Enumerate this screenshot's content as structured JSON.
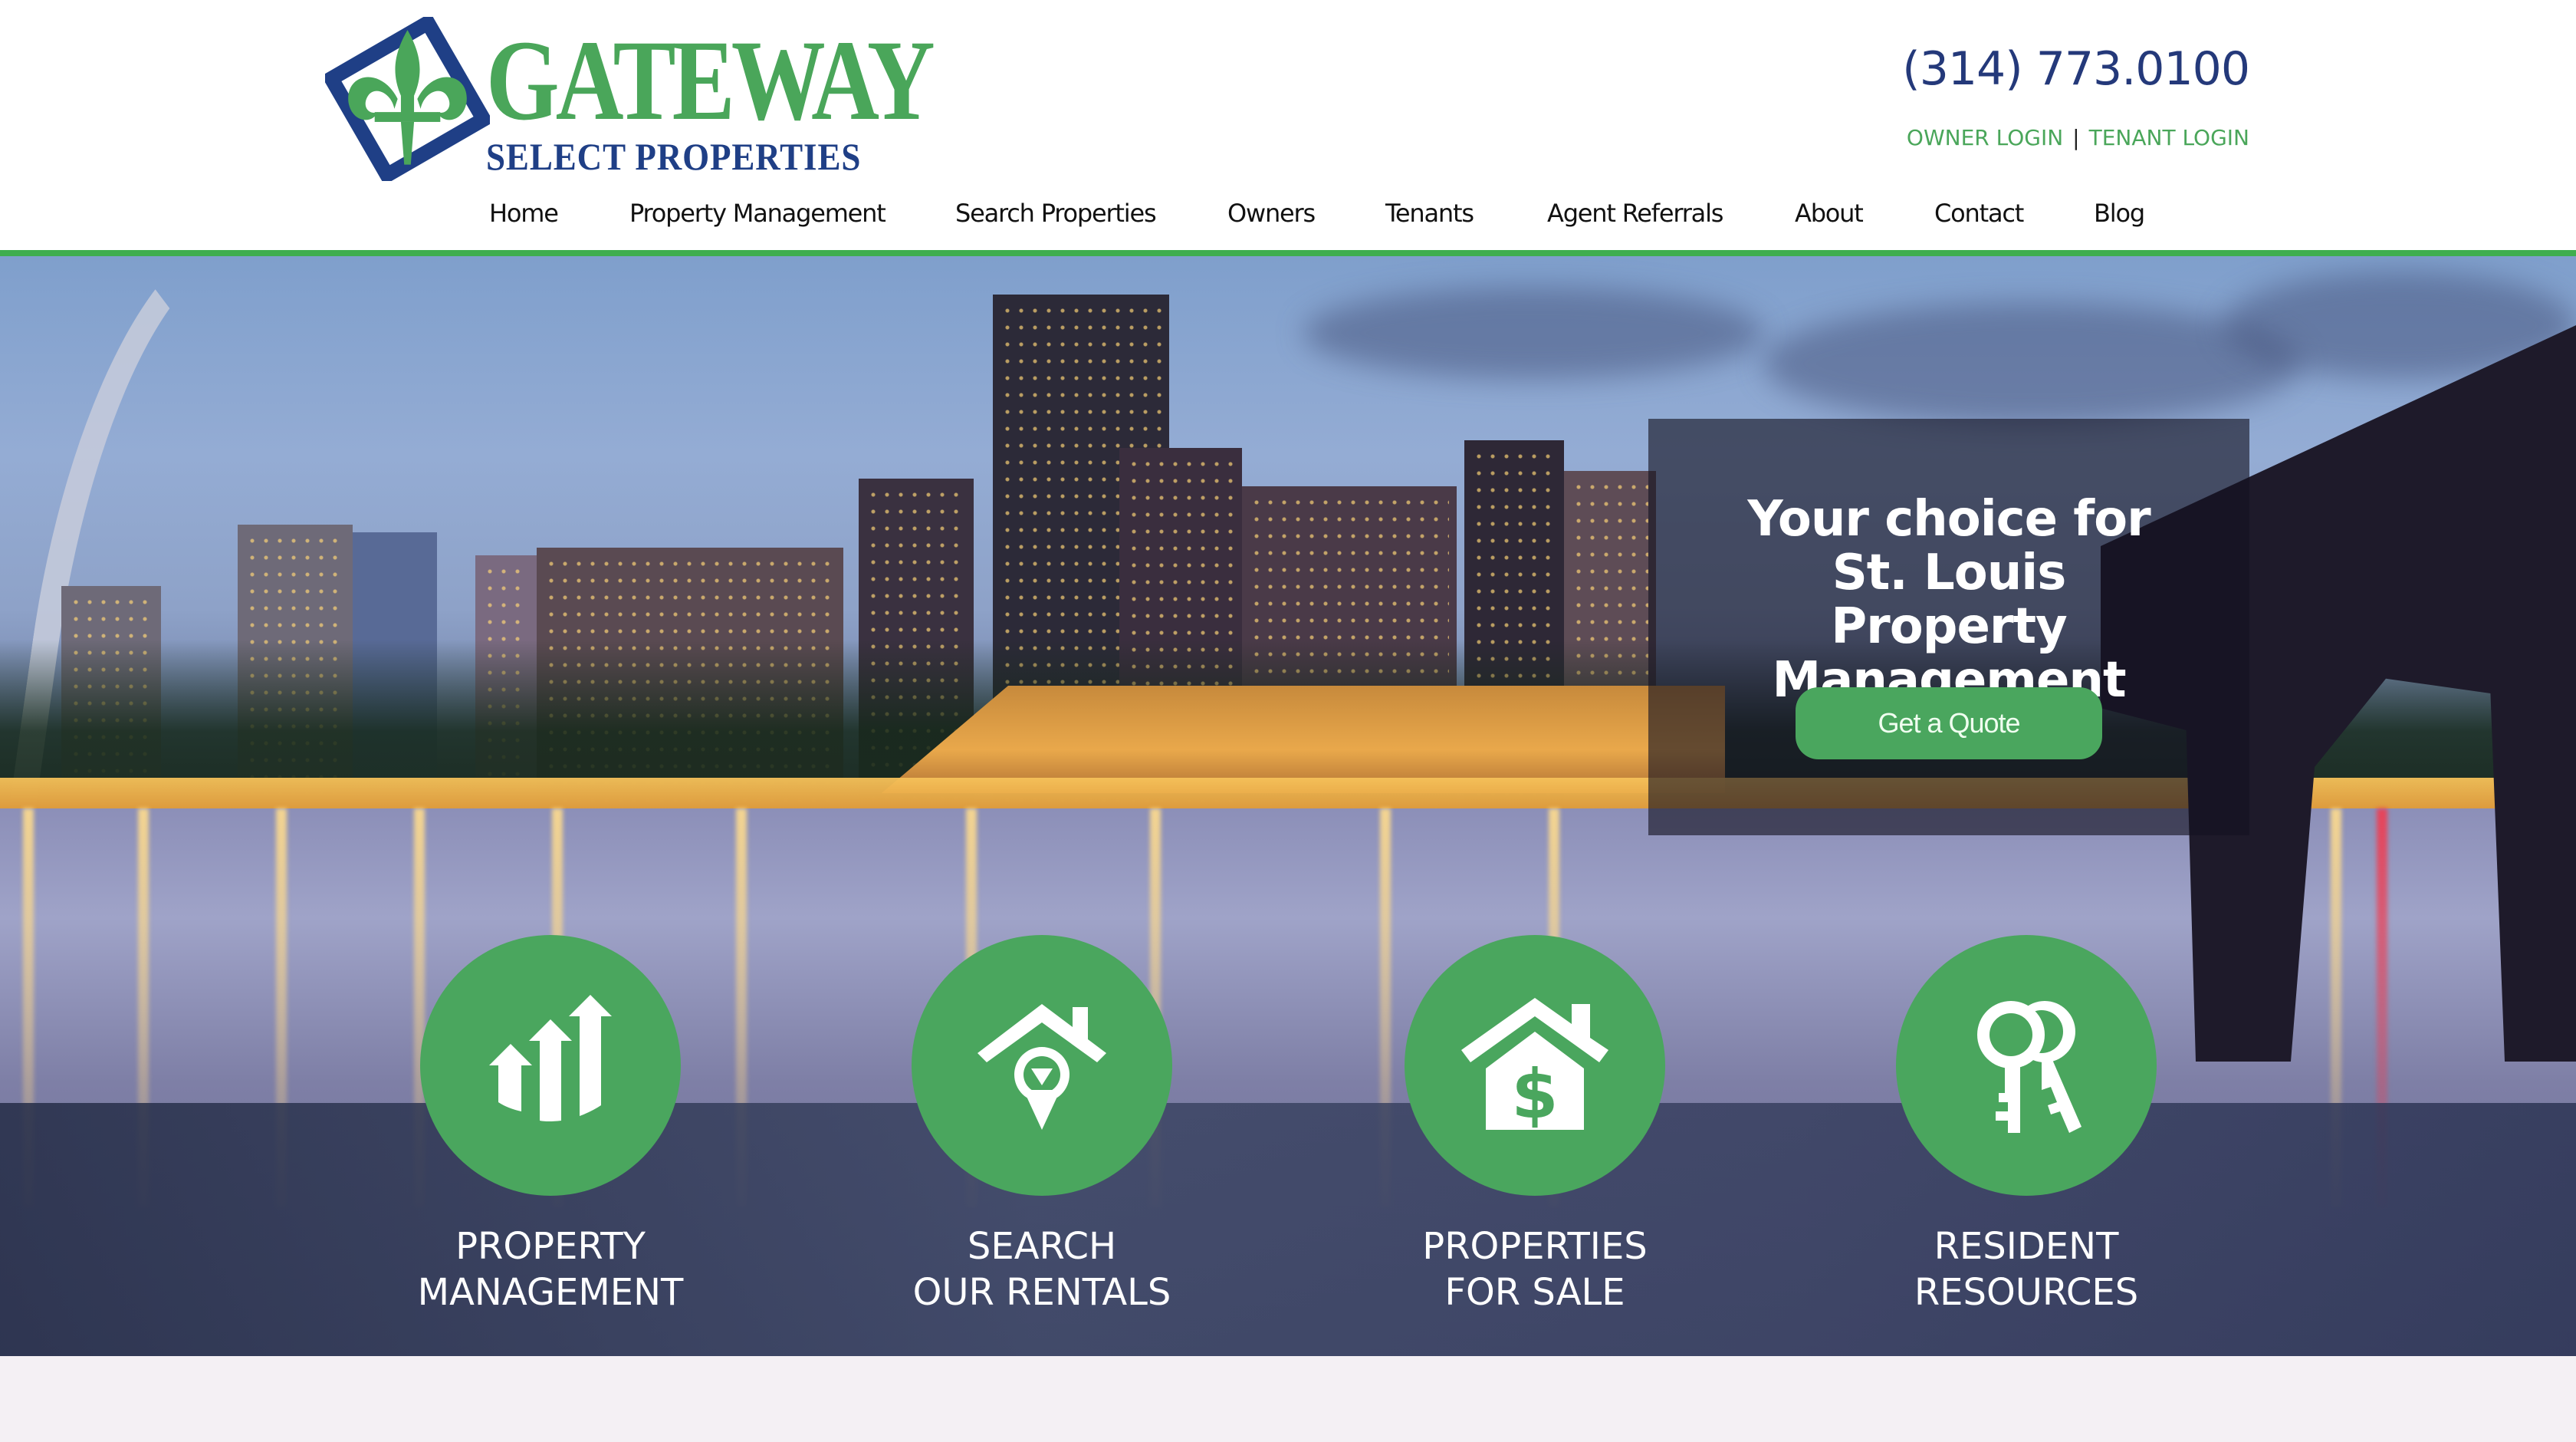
{
  "brand": {
    "name": "GATEWAY",
    "tagline": "SELECT PROPERTIES",
    "colors": {
      "green": "#4aa65a",
      "navy": "#1f3f86",
      "accent_rule": "#3fae4f",
      "button": "#4aa65e"
    }
  },
  "header": {
    "phone": "(314) 773.0100",
    "owner_login": "OWNER LOGIN",
    "separator": "|",
    "tenant_login": "TENANT LOGIN"
  },
  "nav": {
    "items": [
      {
        "label": "Home"
      },
      {
        "label": "Property Management"
      },
      {
        "label": "Search Properties"
      },
      {
        "label": "Owners"
      },
      {
        "label": "Tenants"
      },
      {
        "label": "Agent Referrals"
      },
      {
        "label": "About"
      },
      {
        "label": "Contact"
      },
      {
        "label": "Blog"
      }
    ]
  },
  "hero": {
    "image_subject": "St. Louis skyline at dusk over the river",
    "headline": "Your choice for St. Louis Property Management",
    "cta_label": "Get a Quote"
  },
  "features": [
    {
      "icon": "growth-arrows-icon",
      "line1": "PROPERTY",
      "line2": "MANAGEMENT"
    },
    {
      "icon": "house-location-pin-icon",
      "line1": "SEARCH",
      "line2": "OUR RENTALS"
    },
    {
      "icon": "house-dollar-icon",
      "line1": "PROPERTIES",
      "line2": "FOR SALE"
    },
    {
      "icon": "keys-icon",
      "line1": "RESIDENT",
      "line2": "RESOURCES"
    }
  ]
}
